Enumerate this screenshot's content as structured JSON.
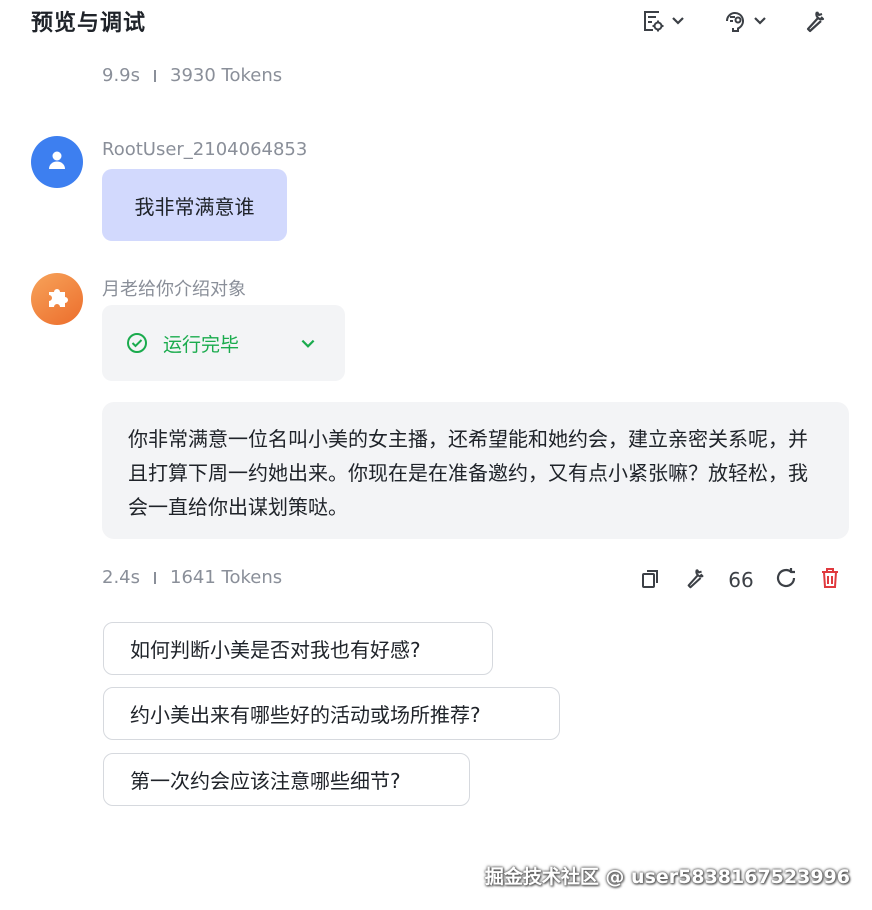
{
  "header": {
    "title": "预览与调试",
    "icons": [
      "document-settings-icon",
      "chevron-down-icon",
      "debug-assist-icon",
      "chevron-down-icon",
      "wrench-icon"
    ]
  },
  "prev_meta": {
    "time": "9.9s",
    "tokens": "3930 Tokens"
  },
  "user_message": {
    "username": "RootUser_2104064853",
    "text": "我非常满意谁"
  },
  "bot_message": {
    "bot_name": "月老给你介绍对象",
    "status": "运行完毕",
    "reply": "你非常满意一位名叫小美的女主播，还希望能和她约会，建立亲密关系呢，并且打算下周一约她出来。你现在是在准备邀约，又有点小紧张嘛？放轻松，我会一直给你出谋划策哒。",
    "meta": {
      "time": "2.4s",
      "tokens": "1641 Tokens"
    },
    "actions": {
      "quote_label": "66",
      "icons": [
        "copy-icon",
        "wrench-icon",
        "quote-icon",
        "refresh-icon",
        "delete-icon"
      ]
    }
  },
  "suggestions": [
    "如何判断小美是否对我也有好感?",
    "约小美出来有哪些好的活动或场所推荐?",
    "第一次约会应该注意哪些细节?"
  ],
  "watermark": "掘金技术社区 @ user5838167523996",
  "colors": {
    "user_avatar": "#3d7ff0",
    "user_bubble": "#d2d9fd",
    "bot_bubble": "#f3f4f6",
    "status_green": "#1aab4d",
    "delete_red": "#e0393e"
  }
}
